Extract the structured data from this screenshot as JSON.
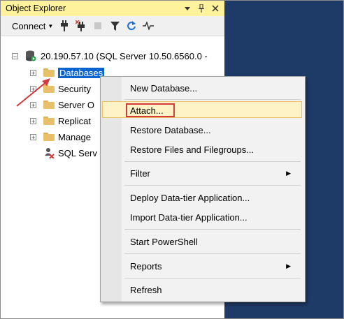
{
  "panel": {
    "title": "Object Explorer",
    "title_icons": [
      "dropdown-icon",
      "pin-icon",
      "close-icon"
    ]
  },
  "toolbar": {
    "connect_label": "Connect",
    "icons": [
      "connect-plug-icon",
      "disconnect-icon",
      "stop-icon",
      "filter-icon",
      "refresh-icon",
      "activity-monitor-icon"
    ]
  },
  "tree": {
    "server": "20.190.57.10 (SQL Server 10.50.6560.0 -",
    "nodes": [
      {
        "label": "Databases",
        "selected": true
      },
      {
        "label": "Security"
      },
      {
        "label": "Server O"
      },
      {
        "label": "Replicat"
      },
      {
        "label": "Manage"
      },
      {
        "label": "SQL Serv"
      }
    ]
  },
  "context_menu": {
    "items": [
      {
        "label": "New Database..."
      },
      {
        "label": "Attach...",
        "highlighted": true
      },
      {
        "label": "Restore Database..."
      },
      {
        "label": "Restore Files and Filegroups..."
      },
      {
        "label": "Filter",
        "submenu": true
      },
      {
        "label": "Deploy Data-tier Application..."
      },
      {
        "label": "Import Data-tier Application..."
      },
      {
        "label": "Start PowerShell"
      },
      {
        "label": "Reports",
        "submenu": true
      },
      {
        "label": "Refresh"
      }
    ]
  },
  "colors": {
    "title_bar": "#fff29d",
    "selection": "#0a64d0",
    "annotation": "#d43a3a",
    "background": "#1e3a66"
  }
}
